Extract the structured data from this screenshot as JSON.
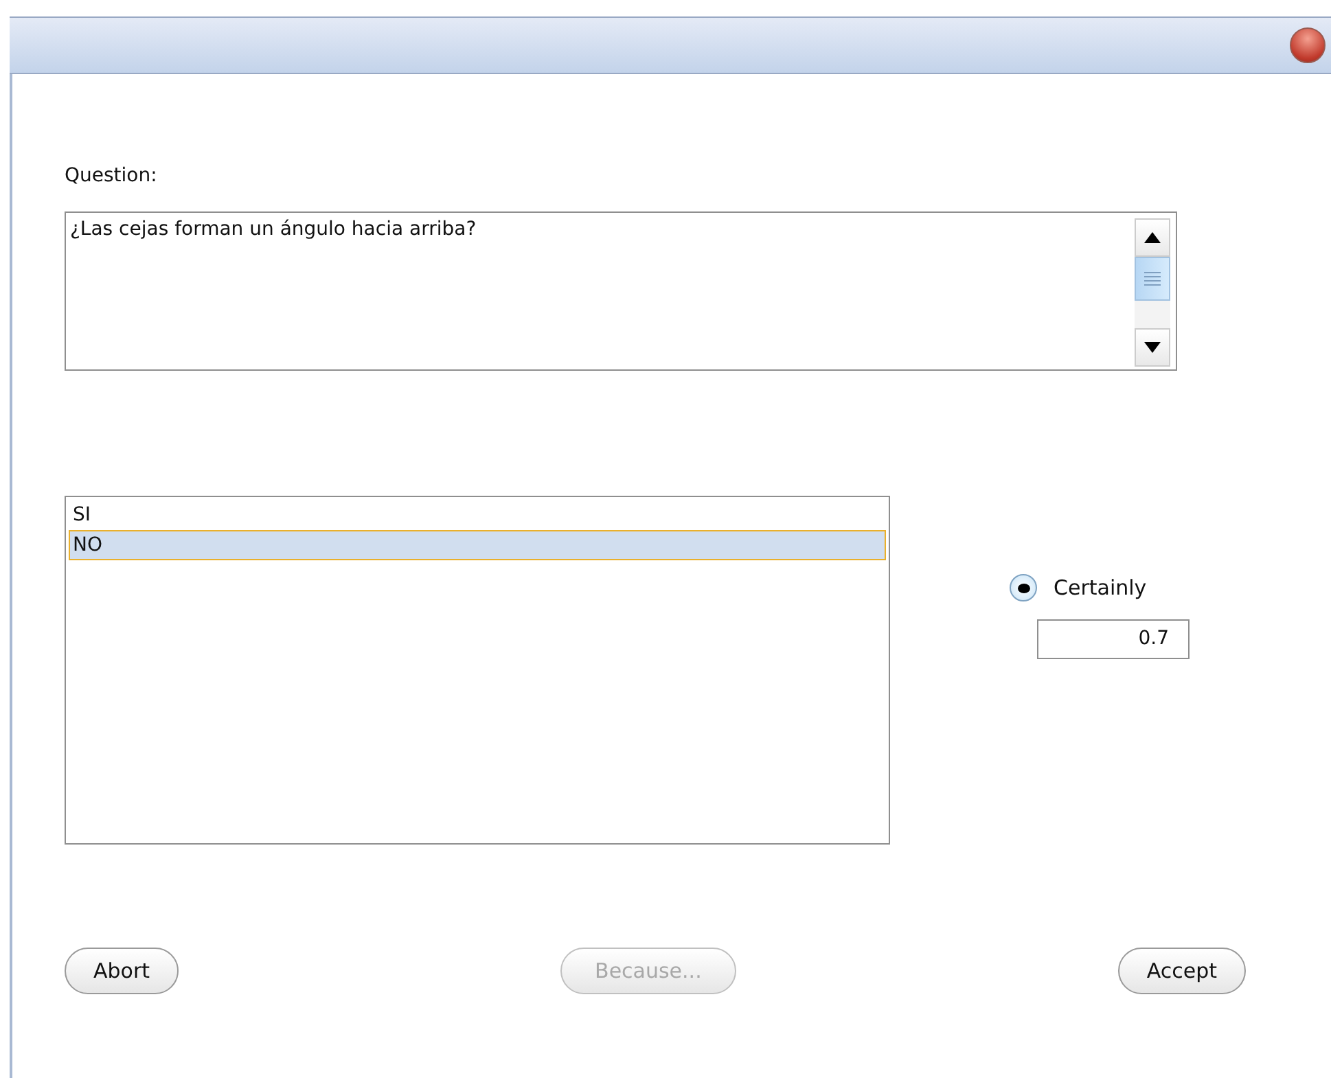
{
  "question": {
    "label": "Question:",
    "text": "¿Las cejas forman un ángulo hacia arriba?"
  },
  "answers": [
    {
      "label": "SI",
      "selected": false
    },
    {
      "label": "NO",
      "selected": true
    }
  ],
  "certainty": {
    "label": "Certainly",
    "selected": true,
    "value": "0.7"
  },
  "buttons": [
    {
      "label": "Abort",
      "disabled": false
    },
    {
      "label": "Because...",
      "disabled": true
    },
    {
      "label": "Accept",
      "disabled": false
    }
  ]
}
